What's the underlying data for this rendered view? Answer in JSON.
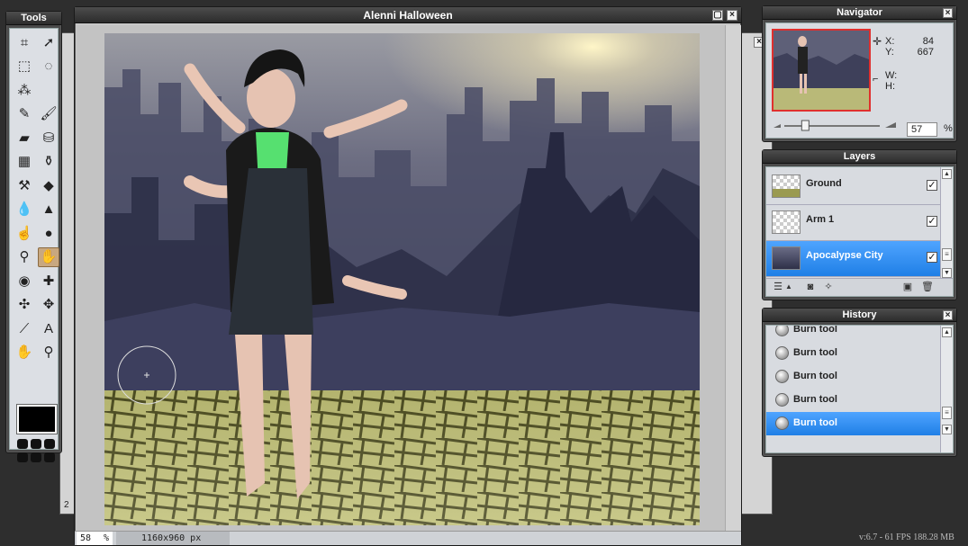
{
  "tools_panel": {
    "title": "Tools",
    "tools": [
      {
        "name": "crop-tool-icon",
        "glyph": "⌗"
      },
      {
        "name": "move-tool-icon",
        "glyph": "➚"
      },
      {
        "name": "marquee-tool-icon",
        "glyph": "⬚"
      },
      {
        "name": "lasso-tool-icon",
        "glyph": "◌"
      },
      {
        "name": "magic-wand-icon",
        "glyph": "⁂"
      },
      {
        "name": "empty-slot",
        "glyph": ""
      },
      {
        "name": "pencil-tool-icon",
        "glyph": "✎"
      },
      {
        "name": "brush-tool-icon",
        "glyph": "🖌"
      },
      {
        "name": "eraser-tool-icon",
        "glyph": "▰"
      },
      {
        "name": "paint-bucket-icon",
        "glyph": "⛁"
      },
      {
        "name": "gradient-tool-icon",
        "glyph": "▦"
      },
      {
        "name": "clone-stamp-icon",
        "glyph": "⚱"
      },
      {
        "name": "color-replace-icon",
        "glyph": "⚒"
      },
      {
        "name": "shape-tool-icon",
        "glyph": "◆"
      },
      {
        "name": "blur-tool-icon",
        "glyph": "💧"
      },
      {
        "name": "sharpen-tool-icon",
        "glyph": "▲"
      },
      {
        "name": "smudge-tool-icon",
        "glyph": "☝"
      },
      {
        "name": "sponge-tool-icon",
        "glyph": "●"
      },
      {
        "name": "dodge-tool-icon",
        "glyph": "⚲"
      },
      {
        "name": "burn-tool-icon",
        "glyph": "✋"
      },
      {
        "name": "red-eye-tool-icon",
        "glyph": "◉"
      },
      {
        "name": "spot-heal-icon",
        "glyph": "✚"
      },
      {
        "name": "bloat-tool-icon",
        "glyph": "✣"
      },
      {
        "name": "pinch-tool-icon",
        "glyph": "✥"
      },
      {
        "name": "color-picker-icon",
        "glyph": "⟋"
      },
      {
        "name": "text-tool-icon",
        "glyph": "A"
      },
      {
        "name": "hand-tool-icon",
        "glyph": "✋"
      },
      {
        "name": "zoom-tool-icon",
        "glyph": "⚲"
      }
    ],
    "active_tool_index": 19
  },
  "document": {
    "title": "Alenni Halloween",
    "zoom_value": "58",
    "zoom_unit": "%",
    "size": "1160x960 px",
    "background_window_number": "2"
  },
  "navigator": {
    "title": "Navigator",
    "x_label": "X:",
    "x_value": "84",
    "y_label": "Y:",
    "y_value": "667",
    "w_label": "W:",
    "h_label": "H:",
    "zoom_value": "57",
    "zoom_unit": "%",
    "slider_fraction": 0.22
  },
  "layers": {
    "title": "Layers",
    "items": [
      {
        "name": "Ground",
        "visible": true,
        "selected": false
      },
      {
        "name": "Arm 1",
        "visible": true,
        "selected": false
      },
      {
        "name": "Apocalypse City",
        "visible": true,
        "selected": true
      }
    ]
  },
  "history": {
    "title": "History",
    "items": [
      {
        "name": "Burn tool",
        "selected": false
      },
      {
        "name": "Burn tool",
        "selected": false
      },
      {
        "name": "Burn tool",
        "selected": false
      },
      {
        "name": "Burn tool",
        "selected": false
      },
      {
        "name": "Burn tool",
        "selected": true
      }
    ]
  },
  "status": {
    "version": "v:6.7 - 61 FPS 188.28 MB"
  },
  "colors": {
    "selection_blue": "#2f8ff0",
    "panel_dark": "#4a4a4a",
    "navigator_frame": "#e0302e",
    "foreground_color": "#000000"
  }
}
